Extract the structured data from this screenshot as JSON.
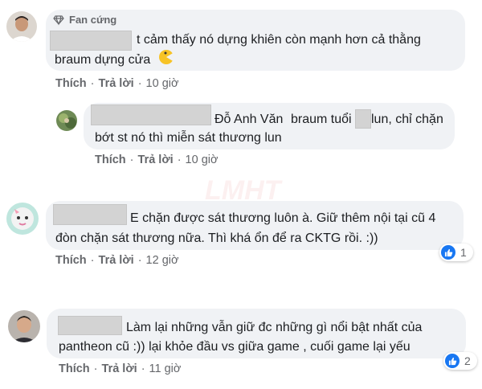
{
  "comments": [
    {
      "badge": "Fan cứng",
      "line1": "t cảm thấy nó dựng khiên còn mạnh hơn cả thằng",
      "line2": "braum dựng cửa",
      "emoji_icon": "pacman-emoji-icon",
      "actions": {
        "like": "Thích",
        "reply": "Trả lời",
        "time": "10 giờ"
      }
    },
    {
      "reply_to": "Đỗ Anh Văn",
      "line1": "braum tuổi",
      "line1_tail": "lun, chỉ chặn",
      "line2": "bớt st nó thì miễn sát thương lun",
      "actions": {
        "like": "Thích",
        "reply": "Trả lời",
        "time": "10 giờ"
      }
    },
    {
      "line1": "E chặn được sát thương luôn à. Giữ thêm nội tại cũ 4",
      "line2": "đòn chặn sát thương nữa. Thì khá ổn để ra CKTG rồi. :))",
      "actions": {
        "like": "Thích",
        "reply": "Trả lời",
        "time": "12 giờ"
      },
      "reactions": {
        "icon": "like-icon",
        "count": "1"
      }
    },
    {
      "line1": "Làm lại những vẫn giữ đc những gì nổi bật nhất của",
      "line2": "pantheon cũ :)) lại khỏe đầu vs giữa game , cuối game lại yếu",
      "actions": {
        "like": "Thích",
        "reply": "Trả lời",
        "time": "11 giờ"
      },
      "reactions": {
        "icon": "like-icon",
        "count": "2"
      }
    }
  ],
  "colors": {
    "bubble": "#f0f2f5",
    "meta": "#65676b",
    "like_blue": "#1877f2"
  }
}
